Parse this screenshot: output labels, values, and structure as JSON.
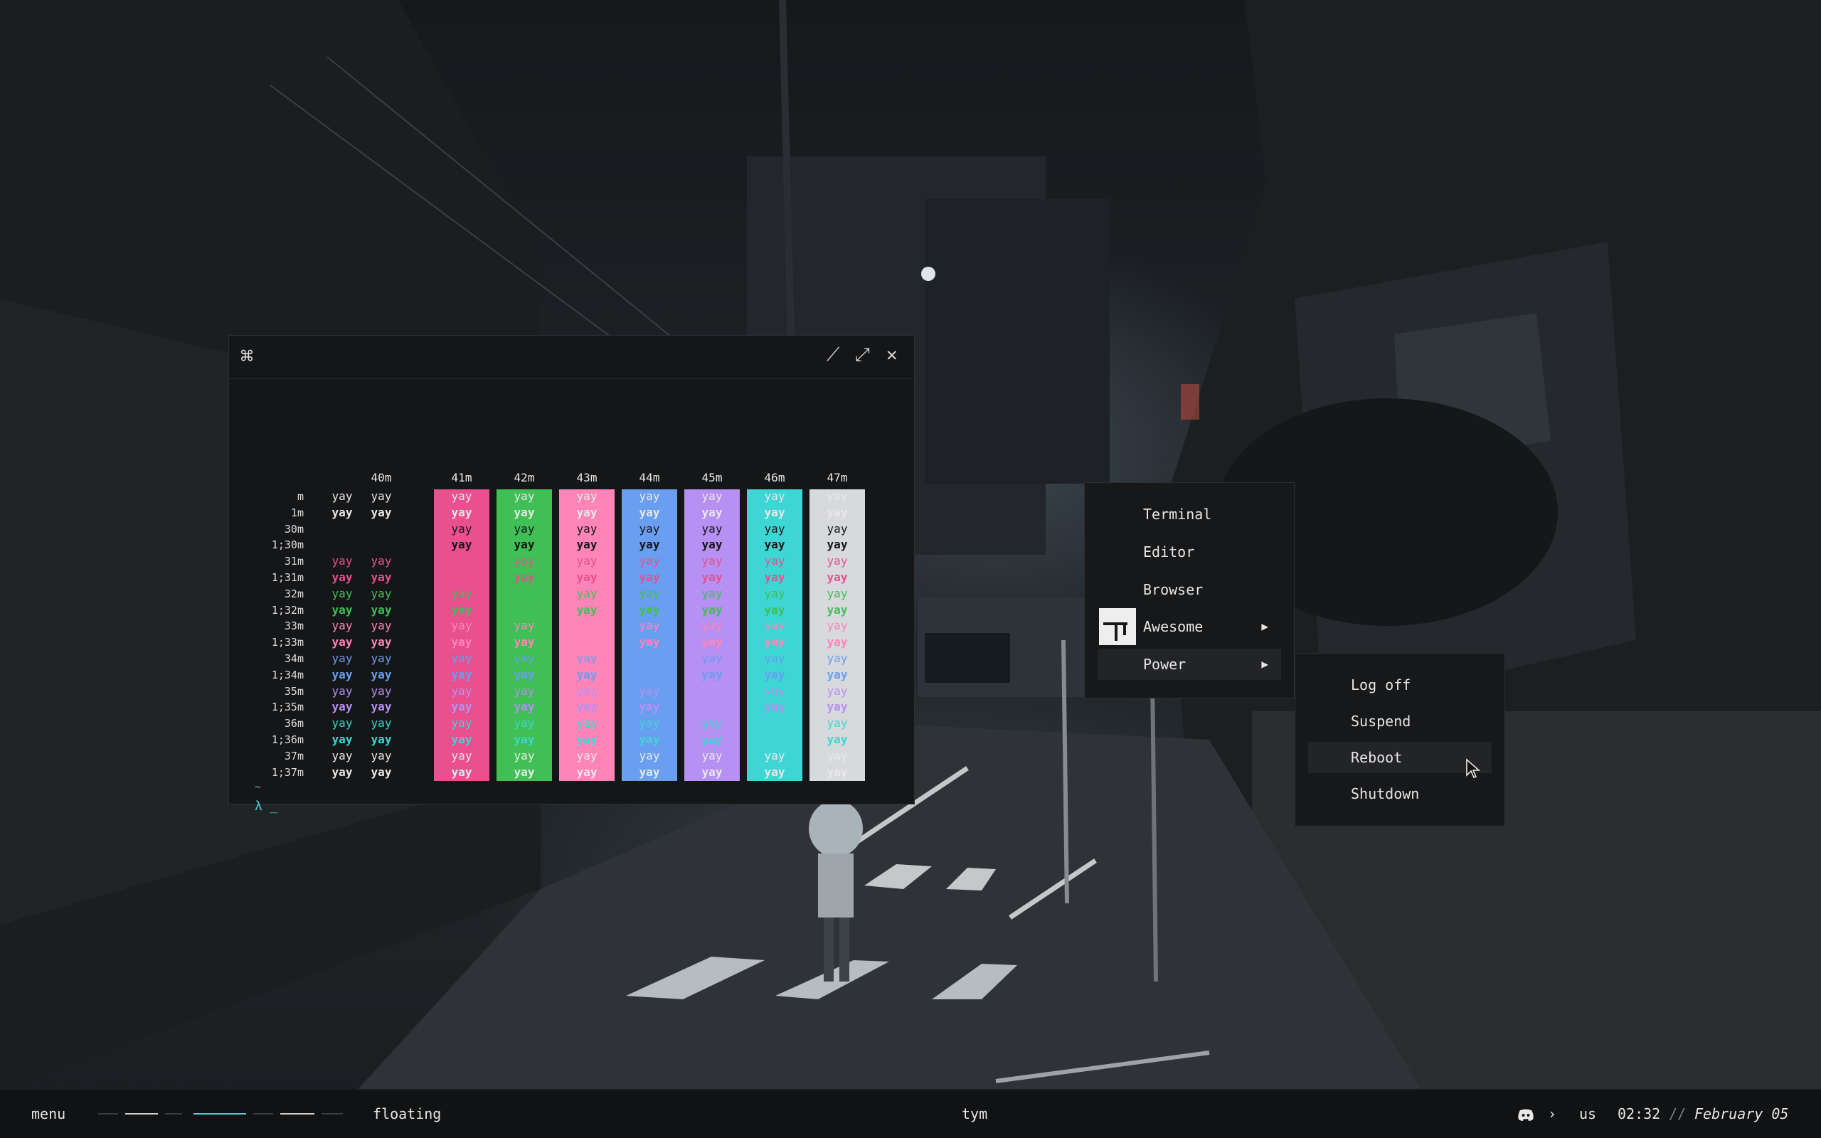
{
  "terminal": {
    "title_icon": "command-key-icon",
    "controls": [
      "minimize-icon",
      "maximize-icon",
      "close-icon"
    ],
    "columns": [
      "40m",
      "41m",
      "42m",
      "43m",
      "44m",
      "45m",
      "46m",
      "47m"
    ],
    "rows": [
      "m",
      "1m",
      "30m",
      "1;30m",
      "31m",
      "1;31m",
      "32m",
      "1;32m",
      "33m",
      "1;33m",
      "34m",
      "1;34m",
      "35m",
      "1;35m",
      "36m",
      "1;36m",
      "37m",
      "1;37m"
    ],
    "cell_text": "yay",
    "tilde": "~",
    "prompt": "λ _"
  },
  "colors": {
    "bg40": "#151618",
    "bg41": "#e8508f",
    "bg42": "#3fbf55",
    "bg43": "#ff85b8",
    "bg44": "#6a9ef0",
    "bg45": "#b690f2",
    "bg46": "#3ed6d4",
    "bg47": "#d7d9dc",
    "fg30": "#151618",
    "fg31": "#e8508f",
    "fg32": "#3fbf55",
    "fg33": "#ff85b8",
    "fg34": "#6a9ef0",
    "fg35": "#b690f2",
    "fg36": "#3ed6d4",
    "fg37": "#e8e8e8",
    "accent": "#4fd1d4"
  },
  "main_menu": {
    "items": [
      {
        "label": "Terminal"
      },
      {
        "label": "Editor"
      },
      {
        "label": "Browser"
      },
      {
        "label": "Awesome",
        "arrow": "▶"
      },
      {
        "label": "Power",
        "arrow": "▶"
      }
    ]
  },
  "power_menu": {
    "items": [
      {
        "label": "Log off"
      },
      {
        "label": "Suspend"
      },
      {
        "label": "Reboot"
      },
      {
        "label": "Shutdown"
      }
    ]
  },
  "bar": {
    "menu_label": "menu",
    "layout": "floating",
    "client": "tym",
    "chevron": "›",
    "keyboard": "us",
    "time": "02:32",
    "separator": "//",
    "date": "February 05",
    "tray_icon": "discord-icon"
  }
}
